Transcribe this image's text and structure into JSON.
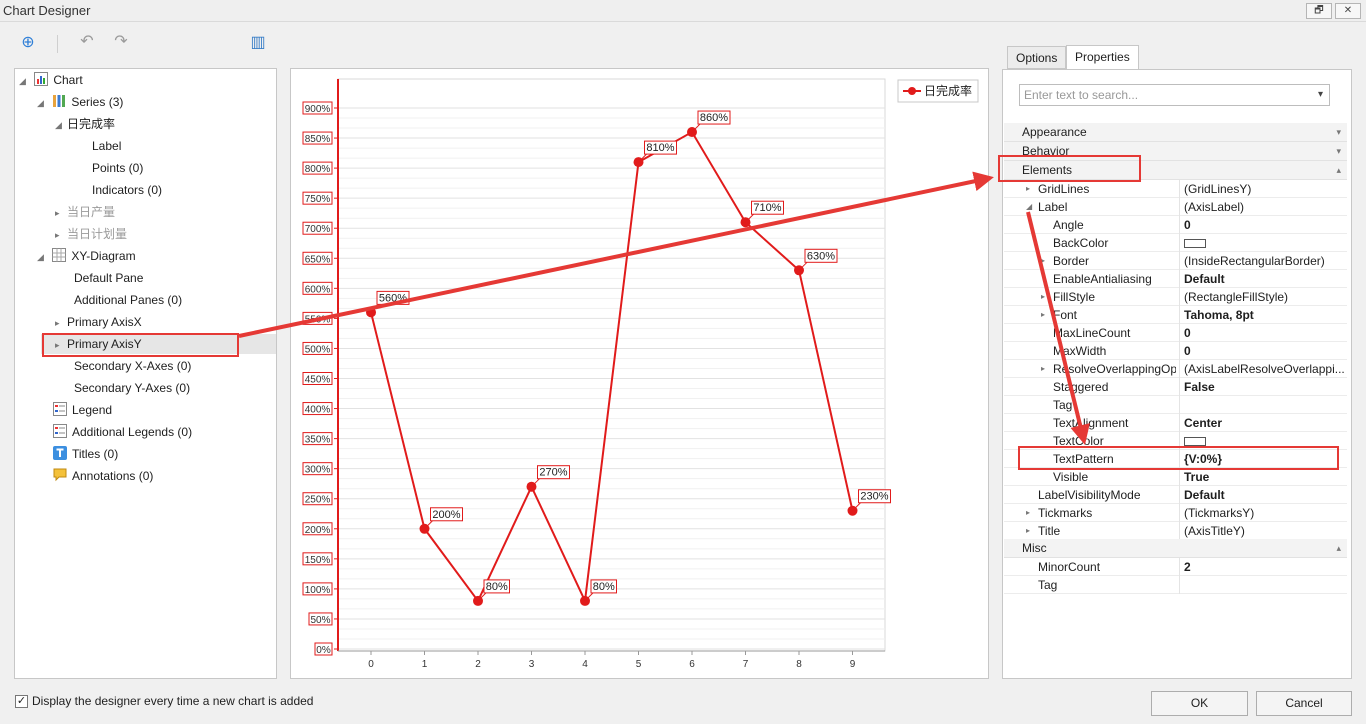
{
  "window": {
    "title": "Chart Designer",
    "restore_glyph": "🗗",
    "close_glyph": "✕"
  },
  "toolbar": {
    "add_icon": "⊕",
    "undo_icon": "↶",
    "redo_icon": "↷",
    "wizard_icon": "▥"
  },
  "tree": {
    "chart": "Chart",
    "series": "Series (3)",
    "series_1": "日完成率",
    "label": "Label",
    "points": "Points (0)",
    "indicators": "Indicators (0)",
    "series_2": "当日产量",
    "series_3": "当日计划量",
    "xy_diagram": "XY-Diagram",
    "default_pane": "Default Pane",
    "additional_panes": "Additional Panes (0)",
    "primary_axis_x": "Primary AxisX",
    "primary_axis_y": "Primary AxisY",
    "secondary_x_axes": "Secondary X-Axes (0)",
    "secondary_y_axes": "Secondary Y-Axes (0)",
    "legend": "Legend",
    "additional_legends": "Additional Legends (0)",
    "titles": "Titles (0)",
    "annotations": "Annotations (0)"
  },
  "chart_data": {
    "type": "line",
    "categories": [
      "0",
      "1",
      "2",
      "3",
      "4",
      "5",
      "6",
      "7",
      "8",
      "9"
    ],
    "series": [
      {
        "name": "日完成率",
        "x": [
          0,
          1,
          2,
          3,
          4,
          5,
          6,
          7,
          8,
          9
        ],
        "values": [
          560,
          200,
          80,
          270,
          80,
          810,
          860,
          710,
          630,
          230
        ],
        "labels": [
          "560%",
          "200%",
          "80%",
          "270%",
          "80%",
          "810%",
          "860%",
          "710%",
          "630%",
          "230%"
        ]
      }
    ],
    "y_ticks": [
      "0%",
      "50%",
      "100%",
      "150%",
      "200%",
      "250%",
      "300%",
      "350%",
      "400%",
      "450%",
      "500%",
      "550%",
      "600%",
      "650%",
      "700%",
      "750%",
      "800%",
      "850%",
      "900%"
    ],
    "ylim": [
      0,
      900
    ],
    "color": "#e11b1b",
    "legend_position": "top-right",
    "grid": true
  },
  "tabs": {
    "options": "Options",
    "properties": "Properties"
  },
  "search": {
    "placeholder": "Enter text to search...",
    "dropdown_glyph": "▾"
  },
  "categories": {
    "appearance": "Appearance",
    "behavior": "Behavior",
    "elements": "Elements",
    "misc": "Misc"
  },
  "props": [
    {
      "name": "GridLines",
      "value": "(GridLinesY)",
      "bold": false,
      "indent": 1,
      "expander": "right"
    },
    {
      "name": "Label",
      "value": "(AxisLabel)",
      "bold": false,
      "indent": 1,
      "expander": "down"
    },
    {
      "name": "Angle",
      "value": "0",
      "bold": true,
      "indent": 2
    },
    {
      "name": "BackColor",
      "value": "",
      "bold": false,
      "indent": 2,
      "swatch": true
    },
    {
      "name": "Border",
      "value": "(InsideRectangularBorder)",
      "bold": false,
      "indent": 2,
      "expander": "right"
    },
    {
      "name": "EnableAntialiasing",
      "value": "Default",
      "bold": true,
      "indent": 2
    },
    {
      "name": "FillStyle",
      "value": "(RectangleFillStyle)",
      "bold": false,
      "indent": 2,
      "expander": "right"
    },
    {
      "name": "Font",
      "value": "Tahoma, 8pt",
      "bold": true,
      "indent": 2,
      "expander": "right"
    },
    {
      "name": "MaxLineCount",
      "value": "0",
      "bold": true,
      "indent": 2
    },
    {
      "name": "MaxWidth",
      "value": "0",
      "bold": true,
      "indent": 2
    },
    {
      "name": "ResolveOverlappingOp",
      "value": "(AxisLabelResolveOverlappi...",
      "bold": false,
      "indent": 2,
      "expander": "right"
    },
    {
      "name": "Staggered",
      "value": "False",
      "bold": true,
      "indent": 2
    },
    {
      "name": "Tag",
      "value": "",
      "bold": false,
      "indent": 2
    },
    {
      "name": "TextAlignment",
      "value": "Center",
      "bold": true,
      "indent": 2
    },
    {
      "name": "TextColor",
      "value": "",
      "bold": false,
      "indent": 2,
      "swatch": true
    },
    {
      "name": "TextPattern",
      "value": "{V:0%}",
      "bold": true,
      "indent": 2
    },
    {
      "name": "Visible",
      "value": "True",
      "bold": true,
      "indent": 2
    },
    {
      "name": "LabelVisibilityMode",
      "value": "Default",
      "bold": true,
      "indent": 1
    },
    {
      "name": "Tickmarks",
      "value": "(TickmarksY)",
      "bold": false,
      "indent": 1,
      "expander": "right"
    },
    {
      "name": "Title",
      "value": "(AxisTitleY)",
      "bold": false,
      "indent": 1,
      "expander": "right"
    }
  ],
  "misc_props": [
    {
      "name": "MinorCount",
      "value": "2",
      "bold": true,
      "indent": 1
    },
    {
      "name": "Tag",
      "value": "",
      "bold": false,
      "indent": 1
    }
  ],
  "footer": {
    "checkbox_label": "Display the designer every time a new chart is added",
    "checked_glyph": "✓",
    "ok": "OK",
    "cancel": "Cancel"
  }
}
